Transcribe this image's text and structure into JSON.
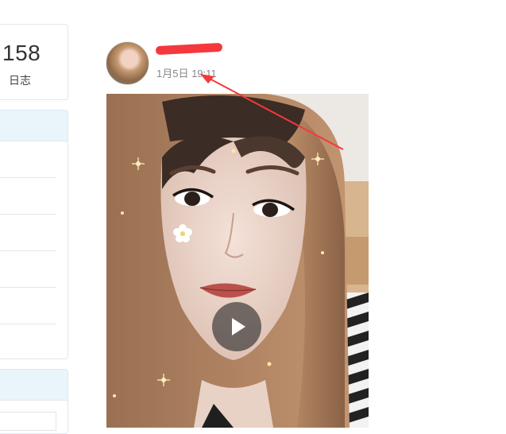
{
  "sidebar": {
    "stat_count": "158",
    "stat_label": "日志"
  },
  "post": {
    "time": "1月5日 19:11",
    "avatar_icon": "user-avatar",
    "media_icon": "video-thumbnail",
    "play_icon": "play-icon"
  },
  "annotation": {
    "color": "#f4383d"
  }
}
